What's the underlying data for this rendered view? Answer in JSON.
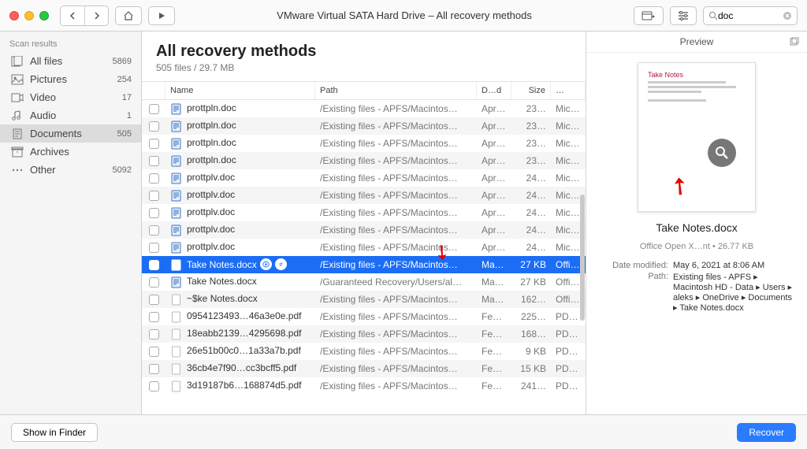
{
  "titlebar": {
    "title": "VMware Virtual SATA Hard Drive – All recovery methods",
    "search_value": "doc"
  },
  "sidebar": {
    "title": "Scan results",
    "items": [
      {
        "icon": "files",
        "label": "All files",
        "count": "5869"
      },
      {
        "icon": "pictures",
        "label": "Pictures",
        "count": "254"
      },
      {
        "icon": "video",
        "label": "Video",
        "count": "17"
      },
      {
        "icon": "audio",
        "label": "Audio",
        "count": "1"
      },
      {
        "icon": "documents",
        "label": "Documents",
        "count": "505"
      },
      {
        "icon": "archives",
        "label": "Archives",
        "count": ""
      },
      {
        "icon": "other",
        "label": "Other",
        "count": "5092"
      }
    ]
  },
  "main": {
    "title": "All recovery methods",
    "subtitle": "505 files / 29.7 MB",
    "columns": {
      "name": "Name",
      "path": "Path",
      "date": "D…d",
      "size": "Size",
      "kind": "…"
    },
    "rows": [
      {
        "icon": "doc",
        "name": "prottpln.doc",
        "path": "/Existing files - APFS/Macintos…",
        "date": "Apr…",
        "size": "23…",
        "kind": "Mic…"
      },
      {
        "icon": "doc",
        "name": "prottpln.doc",
        "path": "/Existing files - APFS/Macintos…",
        "date": "Apr…",
        "size": "23…",
        "kind": "Mic…"
      },
      {
        "icon": "doc",
        "name": "prottpln.doc",
        "path": "/Existing files - APFS/Macintos…",
        "date": "Apr…",
        "size": "23…",
        "kind": "Mic…"
      },
      {
        "icon": "doc",
        "name": "prottpln.doc",
        "path": "/Existing files - APFS/Macintos…",
        "date": "Apr…",
        "size": "23…",
        "kind": "Mic…"
      },
      {
        "icon": "doc",
        "name": "prottplv.doc",
        "path": "/Existing files - APFS/Macintos…",
        "date": "Apr…",
        "size": "24…",
        "kind": "Mic…"
      },
      {
        "icon": "doc",
        "name": "prottplv.doc",
        "path": "/Existing files - APFS/Macintos…",
        "date": "Apr…",
        "size": "24…",
        "kind": "Mic…"
      },
      {
        "icon": "doc",
        "name": "prottplv.doc",
        "path": "/Existing files - APFS/Macintos…",
        "date": "Apr…",
        "size": "24…",
        "kind": "Mic…"
      },
      {
        "icon": "doc",
        "name": "prottplv.doc",
        "path": "/Existing files - APFS/Macintos…",
        "date": "Apr…",
        "size": "24…",
        "kind": "Mic…"
      },
      {
        "icon": "doc",
        "name": "prottplv.doc",
        "path": "/Existing files - APFS/Macintos…",
        "date": "Apr…",
        "size": "24…",
        "kind": "Mic…"
      },
      {
        "icon": "docx",
        "name": "Take Notes.docx",
        "path": "/Existing files - APFS/Macintos…",
        "date": "May…",
        "size": "27 KB",
        "kind": "Offi…",
        "selected": true,
        "badges": true
      },
      {
        "icon": "docx",
        "name": "Take Notes.docx",
        "path": "/Guaranteed Recovery/Users/al…",
        "date": "May…",
        "size": "27 KB",
        "kind": "Offi…"
      },
      {
        "icon": "blank",
        "name": "~$ke Notes.docx",
        "path": "/Existing files - APFS/Macintos…",
        "date": "May…",
        "size": "162…",
        "kind": "Offi…"
      },
      {
        "icon": "blank",
        "name": "0954123493…46a3e0e.pdf",
        "path": "/Existing files - APFS/Macintos…",
        "date": "Feb…",
        "size": "225…",
        "kind": "PDF…"
      },
      {
        "icon": "blank",
        "name": "18eabb2139…4295698.pdf",
        "path": "/Existing files - APFS/Macintos…",
        "date": "Feb…",
        "size": "168…",
        "kind": "PDF…"
      },
      {
        "icon": "blank",
        "name": "26e51b00c0…1a33a7b.pdf",
        "path": "/Existing files - APFS/Macintos…",
        "date": "Feb…",
        "size": "9 KB",
        "kind": "PDF…"
      },
      {
        "icon": "blank",
        "name": "36cb4e7f90…cc3bcff5.pdf",
        "path": "/Existing files - APFS/Macintos…",
        "date": "Feb…",
        "size": "15 KB",
        "kind": "PDF…"
      },
      {
        "icon": "blank",
        "name": "3d19187b6…168874d5.pdf",
        "path": "/Existing files - APFS/Macintos…",
        "date": "Feb…",
        "size": "241…",
        "kind": "PDF…"
      }
    ]
  },
  "preview": {
    "header": "Preview",
    "thumb_title": "Take Notes",
    "filename": "Take Notes.docx",
    "meta": "Office Open X…nt • 26.77 KB",
    "fields": [
      {
        "label": "Date modified:",
        "value": "May 6, 2021 at 8:06 AM"
      },
      {
        "label": "Path:",
        "value": "Existing files - APFS ▸ Macintosh HD - Data ▸ Users ▸ aleks ▸ OneDrive ▸ Documents ▸ Take Notes.docx"
      }
    ]
  },
  "footer": {
    "show_in_finder": "Show in Finder",
    "recover": "Recover"
  }
}
